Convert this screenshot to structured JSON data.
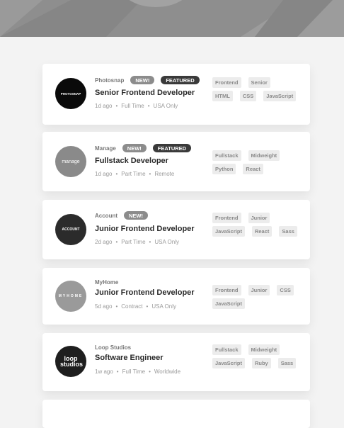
{
  "jobs": [
    {
      "company": "Photosnap",
      "new": "NEW!",
      "featured": "FEATURED",
      "position": "Senior Frontend Developer",
      "posted": "1d ago",
      "contract": "Full Time",
      "location": "USA Only",
      "logo_text": "PHOTOSNAP",
      "logo_color": "#0a0a0a",
      "tags": [
        "Frontend",
        "Senior",
        "HTML",
        "CSS",
        "JavaScript"
      ]
    },
    {
      "company": "Manage",
      "new": "NEW!",
      "featured": "FEATURED",
      "position": "Fullstack Developer",
      "posted": "1d ago",
      "contract": "Part Time",
      "location": "Remote",
      "logo_text": "manage",
      "logo_color": "#8a8a8a",
      "tags": [
        "Fullstack",
        "Midweight",
        "Python",
        "React"
      ]
    },
    {
      "company": "Account",
      "new": "NEW!",
      "featured": "",
      "position": "Junior Frontend Developer",
      "posted": "2d ago",
      "contract": "Part Time",
      "location": "USA Only",
      "logo_text": "ACCOUNT",
      "logo_color": "#2b2b2b",
      "tags": [
        "Frontend",
        "Junior",
        "JavaScript",
        "React",
        "Sass"
      ]
    },
    {
      "company": "MyHome",
      "new": "",
      "featured": "",
      "position": "Junior Frontend Developer",
      "posted": "5d ago",
      "contract": "Contract",
      "location": "USA Only",
      "logo_text": "MYHOME",
      "logo_color": "#9a9a9a",
      "tags": [
        "Frontend",
        "Junior",
        "CSS",
        "JavaScript"
      ]
    },
    {
      "company": "Loop Studios",
      "new": "",
      "featured": "",
      "position": "Software Engineer",
      "posted": "1w ago",
      "contract": "Full Time",
      "location": "Worldwide",
      "logo_text": "loop studios",
      "logo_color": "#1e1e1e",
      "tags": [
        "Fullstack",
        "Midweight",
        "JavaScript",
        "Ruby",
        "Sass"
      ]
    }
  ],
  "colors": {
    "header": "#8e8e8e",
    "background": "#f3f3f3",
    "featured_badge": "#3a3a3a",
    "new_badge": "#8c8c8c"
  }
}
